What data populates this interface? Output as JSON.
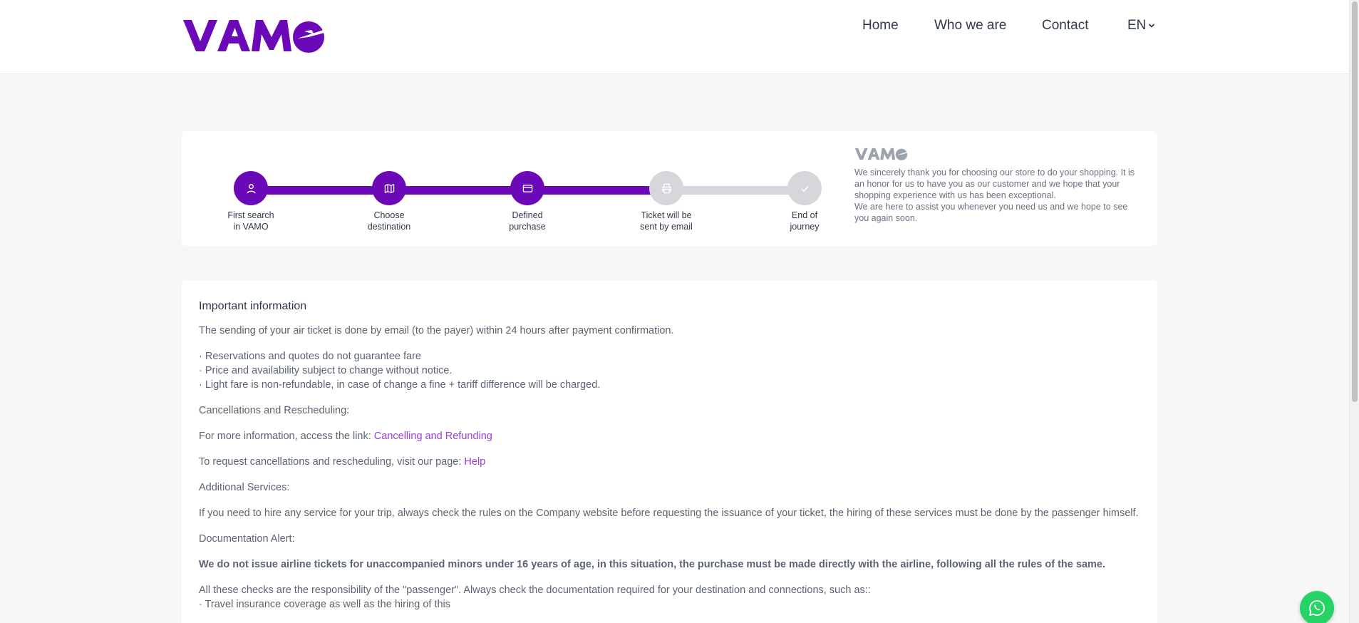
{
  "brand": {
    "name": "VAMO",
    "color": "#6b09b8"
  },
  "nav": {
    "home": "Home",
    "who": "Who we are",
    "contact": "Contact",
    "lang": "EN"
  },
  "steps": [
    {
      "label1": "First search",
      "label2": "in VAMO",
      "icon": "user-icon",
      "done": true
    },
    {
      "label1": "Choose",
      "label2": "destination",
      "icon": "map-icon",
      "done": true
    },
    {
      "label1": "Defined",
      "label2": "purchase",
      "icon": "credit-card-icon",
      "done": true
    },
    {
      "label1": "Ticket will be",
      "label2": "sent by email",
      "icon": "printer-icon",
      "done": false
    },
    {
      "label1": "End of",
      "label2": "journey",
      "icon": "check-icon",
      "done": false
    }
  ],
  "thanks": {
    "p1": "We sincerely thank you for choosing our store to do your shopping. It is an honor for us to have you as our customer and we hope that your shopping experience with us has been exceptional.",
    "p2": "We are here to assist you whenever you need us and we hope to see you again soon."
  },
  "info": {
    "title": "Important information",
    "sending": "The sending of your air ticket is done by email (to the payer) within 24 hours after payment confirmation.",
    "bullets": [
      "· Reservations and quotes do not guarantee fare",
      "· Price and availability subject to change without notice.",
      "· Light fare is non-refundable, in case of change a fine + tariff difference will be charged."
    ],
    "cancel_title": "Cancellations and Rescheduling:",
    "more_info": "For more information, access the link: ",
    "more_info_link": "Cancelling and Refunding",
    "request": "To request cancellations and rescheduling, visit our page: ",
    "request_link": "Help",
    "additional_title": "Additional Services:",
    "additional_text": "If you need to hire any service for your trip, always check the rules on the Company website before requesting the issuance of your ticket, the hiring of these services must be done by the passenger himself.",
    "doc_title": "Documentation Alert:",
    "doc_strong": "We do not issue airline tickets for unaccompanied minors under 16 years of age, in this situation, the purchase must be made directly with the airline, following all the rules of the same.",
    "checks": "All these checks are the responsibility of the \"passenger\". Always check the documentation required for your destination and connections, such as::",
    "checks_bullet": "· Travel insurance coverage as well as the hiring of this"
  }
}
